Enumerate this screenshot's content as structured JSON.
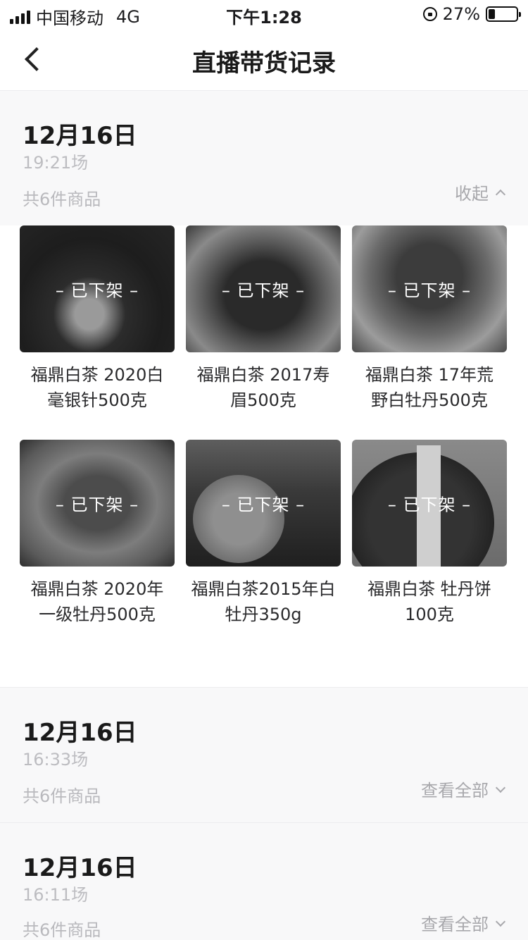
{
  "status_bar": {
    "carrier": "中国移动",
    "network": "4G",
    "time": "下午1:28",
    "battery": "27%"
  },
  "nav": {
    "title": "直播带货记录",
    "back_icon": "chevron-left-icon"
  },
  "sessions": [
    {
      "date": "12月16日",
      "time": "19:21场",
      "count": "共6件商品",
      "toggle_label": "收起",
      "toggle_icon": "chevron-up-icon",
      "products": [
        {
          "name_line1": "福鼎白茶 2020白",
          "name_line2": "毫银针500克",
          "status": "– 已下架 –"
        },
        {
          "name_line1": "福鼎白茶 2017寿",
          "name_line2": "眉500克",
          "status": "– 已下架 –"
        },
        {
          "name_line1": "福鼎白茶 17年荒",
          "name_line2": "野白牡丹500克",
          "status": "– 已下架 –"
        },
        {
          "name_line1": "福鼎白茶 2020年",
          "name_line2": "一级牡丹500克",
          "status": "– 已下架 –"
        },
        {
          "name_line1": "福鼎白茶2015年白",
          "name_line2": "牡丹350g",
          "status": "– 已下架 –"
        },
        {
          "name_line1": "福鼎白茶 牡丹饼",
          "name_line2": "100克",
          "status": "– 已下架 –"
        }
      ]
    },
    {
      "date": "12月16日",
      "time": "16:33场",
      "count": "共6件商品",
      "toggle_label": "查看全部",
      "toggle_icon": "chevron-down-icon"
    },
    {
      "date": "12月16日",
      "time": "16:11场",
      "count": "共6件商品",
      "toggle_label": "查看全部",
      "toggle_icon": "chevron-down-icon"
    }
  ]
}
